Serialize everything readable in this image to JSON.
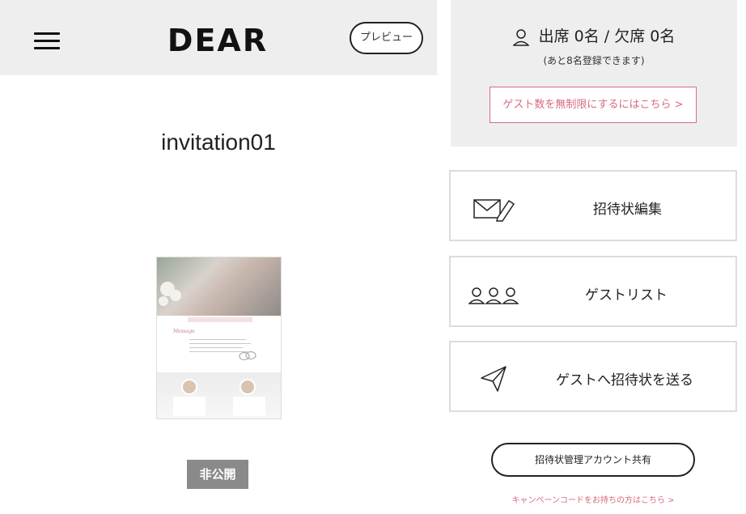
{
  "header": {
    "logo": "DEAR",
    "preview_label": "プレビュー"
  },
  "invitation": {
    "title": "invitation01",
    "visibility_badge": "非公開"
  },
  "attendance": {
    "summary": "出席 0名 / 欠席 0名",
    "remaining": "(あと8名登録できます)",
    "unlimited_link": "ゲスト数を無制限にするにはこちら >"
  },
  "menu": [
    {
      "label": "招待状編集",
      "icon": "envelope-pen-icon"
    },
    {
      "label": "ゲストリスト",
      "icon": "guests-icon"
    },
    {
      "label": "ゲストへ招待状を送る",
      "icon": "paper-plane-icon"
    }
  ],
  "share_button": "招待状管理アカウント共有",
  "campaign_link": "キャンペーンコードをお持ちの方はこちら >",
  "colors": {
    "accent_pink": "#d66b7f",
    "header_bg": "#eeeeee",
    "badge_gray": "#8a8a8a"
  }
}
